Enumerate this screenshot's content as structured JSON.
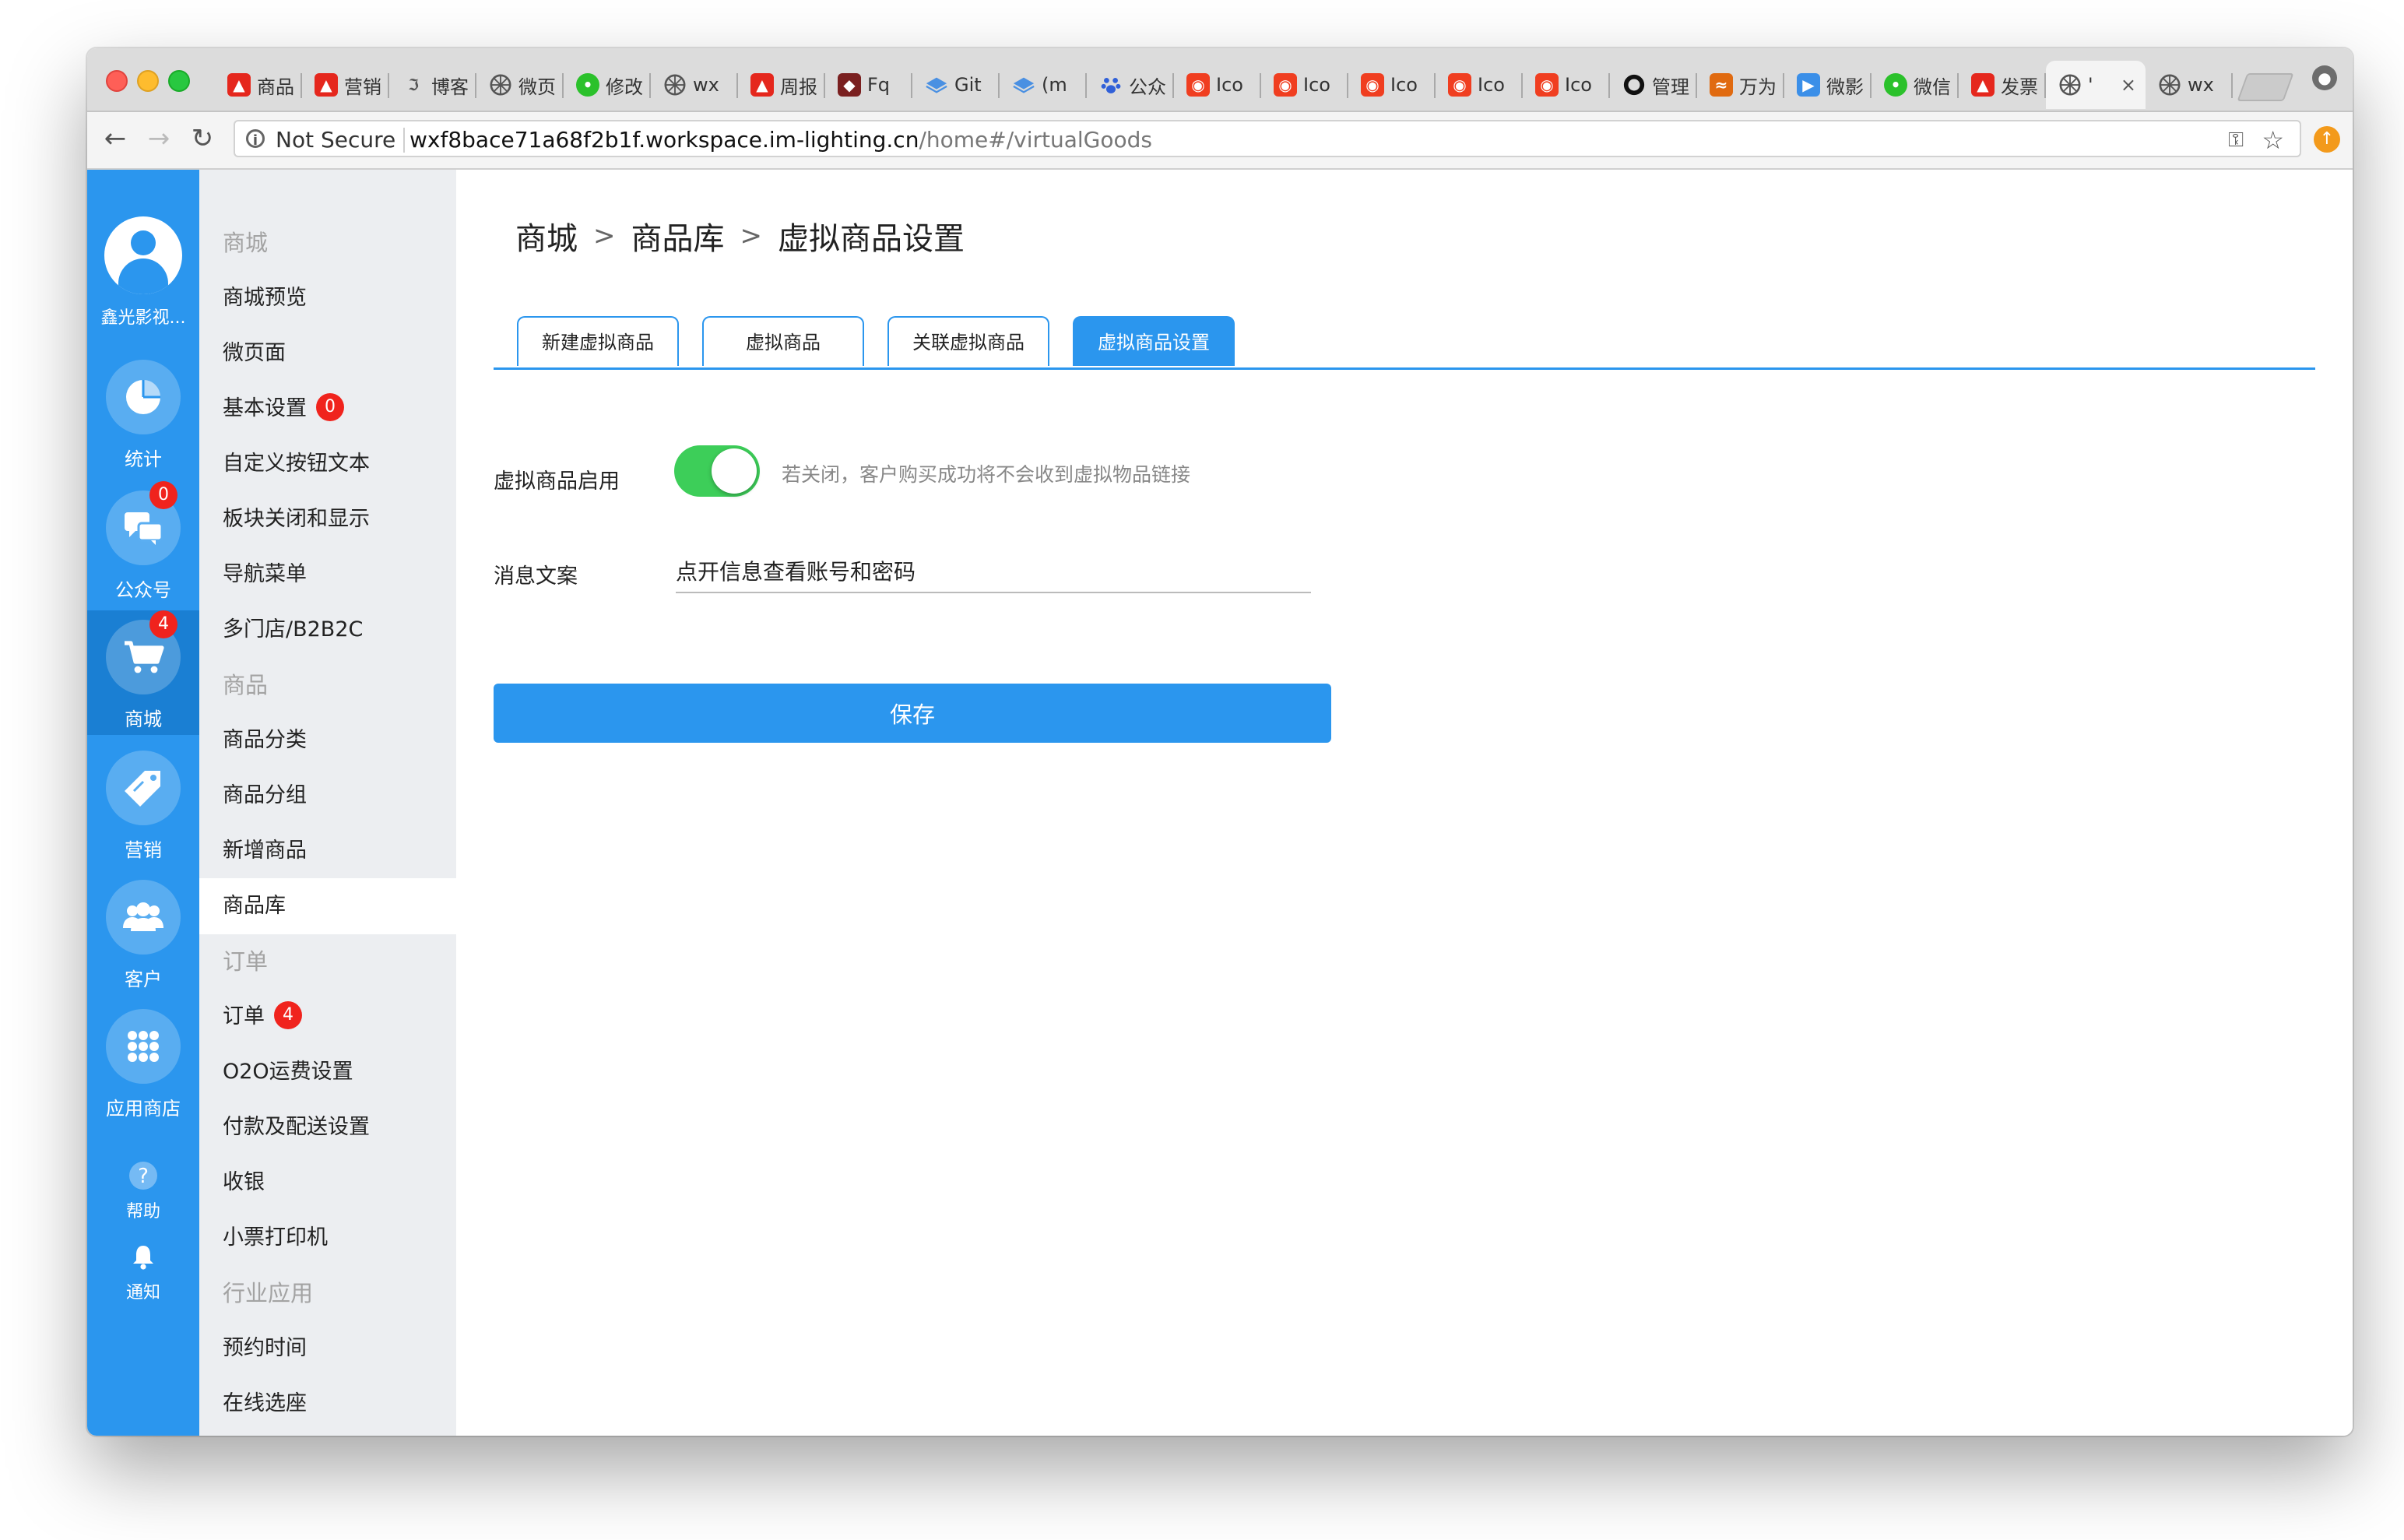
{
  "browser": {
    "tabs": [
      {
        "label": "商品",
        "icon": "thumbs-up-icon",
        "color": "#e5271d"
      },
      {
        "label": "营销",
        "icon": "thumbs-up-icon",
        "color": "#e5271d"
      },
      {
        "label": "博客",
        "icon": "cursive-logo-icon",
        "color": "#555555"
      },
      {
        "label": "微页",
        "icon": "aperture-icon",
        "color": "#555555"
      },
      {
        "label": "修改",
        "icon": "wechat-icon",
        "color": "#2bc12b"
      },
      {
        "label": "wx",
        "icon": "aperture-icon",
        "color": "#555555"
      },
      {
        "label": "周报",
        "icon": "thumbs-up-icon",
        "color": "#e5271d"
      },
      {
        "label": "Fq",
        "icon": "portrait-icon",
        "color": "#7a2020"
      },
      {
        "label": "Git",
        "icon": "stack-icon",
        "color": "#4a90e2"
      },
      {
        "label": "(m",
        "icon": "stack-icon",
        "color": "#4a90e2"
      },
      {
        "label": "公众",
        "icon": "paw-icon",
        "color": "#3060d8"
      },
      {
        "label": "Ico",
        "icon": "iconfont-icon",
        "color": "#f03e20"
      },
      {
        "label": "Ico",
        "icon": "iconfont-icon",
        "color": "#f03e20"
      },
      {
        "label": "Ico",
        "icon": "iconfont-icon",
        "color": "#f03e20"
      },
      {
        "label": "Ico",
        "icon": "iconfont-icon",
        "color": "#f03e20"
      },
      {
        "label": "Ico",
        "icon": "iconfont-icon",
        "color": "#f03e20"
      },
      {
        "label": "管理",
        "icon": "ring-icon",
        "color": "#111111"
      },
      {
        "label": "万为",
        "icon": "fish-icon",
        "color": "#e06a10"
      },
      {
        "label": "微影",
        "icon": "play-icon",
        "color": "#3b8fe8"
      },
      {
        "label": "微信",
        "icon": "wechat-icon",
        "color": "#2bc12b"
      },
      {
        "label": "发票",
        "icon": "thumbs-up-icon",
        "color": "#e5271d"
      },
      {
        "label": "'",
        "icon": "aperture-icon",
        "color": "#555555",
        "active": true
      },
      {
        "label": "wx",
        "icon": "aperture-icon",
        "color": "#555555"
      }
    ],
    "security_label": "Not Secure",
    "url_host": "wxf8bace71a68f2b1f.workspace.im-lighting.cn",
    "url_path": "/home#/virtualGoods"
  },
  "rail": {
    "user_name": "鑫光影视...",
    "items": [
      {
        "label": "统计",
        "icon": "pie-chart-icon",
        "badge": ""
      },
      {
        "label": "公众号",
        "icon": "chat-bubbles-icon",
        "badge": "0"
      },
      {
        "label": "商城",
        "icon": "shopping-cart-icon",
        "badge": "4",
        "active": true
      },
      {
        "label": "营销",
        "icon": "price-tag-icon",
        "badge": ""
      },
      {
        "label": "客户",
        "icon": "users-icon",
        "badge": ""
      },
      {
        "label": "应用商店",
        "icon": "app-grid-icon",
        "badge": ""
      }
    ],
    "help_label": "帮助",
    "notify_label": "通知"
  },
  "submenu": {
    "items": [
      {
        "label": "商城",
        "group": true
      },
      {
        "label": "商城预览"
      },
      {
        "label": "微页面"
      },
      {
        "label": "基本设置",
        "badge": "0"
      },
      {
        "label": "自定义按钮文本"
      },
      {
        "label": "板块关闭和显示"
      },
      {
        "label": "导航菜单"
      },
      {
        "label": "多门店/B2B2C"
      },
      {
        "label": "商品",
        "group": true
      },
      {
        "label": "商品分类"
      },
      {
        "label": "商品分组"
      },
      {
        "label": "新增商品"
      },
      {
        "label": "商品库",
        "active": true
      },
      {
        "label": "订单",
        "group": true
      },
      {
        "label": "订单",
        "badge": "4"
      },
      {
        "label": "O2O运费设置"
      },
      {
        "label": "付款及配送设置"
      },
      {
        "label": "收银"
      },
      {
        "label": "小票打印机"
      },
      {
        "label": "行业应用",
        "group": true
      },
      {
        "label": "预约时间"
      },
      {
        "label": "在线选座"
      }
    ]
  },
  "breadcrumb": [
    "商城",
    "商品库",
    "虚拟商品设置"
  ],
  "tabs": [
    {
      "label": "新建虚拟商品"
    },
    {
      "label": "虚拟商品"
    },
    {
      "label": "关联虚拟商品"
    },
    {
      "label": "虚拟商品设置",
      "active": true
    }
  ],
  "form": {
    "enable_label": "虚拟商品启用",
    "enable_on": true,
    "enable_hint": "若关闭，客户购买成功将不会收到虚拟物品链接",
    "message_label": "消息文案",
    "message_value": "点开信息查看账号和密码",
    "save_label": "保存"
  },
  "colors": {
    "primary": "#2b96ee",
    "toggle_on": "#3dce59",
    "badge": "#f0231d"
  }
}
